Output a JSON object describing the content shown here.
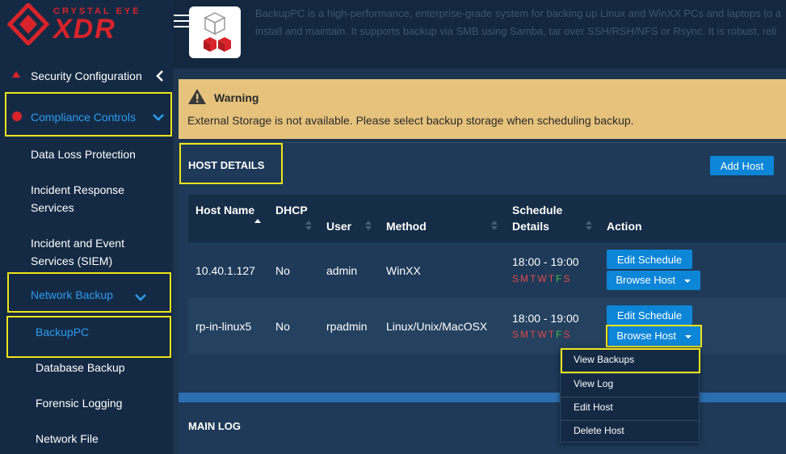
{
  "brand": {
    "tagline": "CRYSTAL EYE",
    "name": "XDR"
  },
  "sidebar": {
    "security_configuration": "Security Configuration",
    "compliance_controls": "Compliance Controls",
    "items": {
      "data_loss_protection": "Data Loss Protection",
      "incident_response_1": "Incident Response",
      "incident_response_2": "Services",
      "incident_event_1": "Incident and Event",
      "incident_event_2": "Services (SIEM)",
      "network_backup": "Network Backup",
      "backuppc": "BackupPC",
      "database_backup": "Database Backup",
      "forensic_logging": "Forensic Logging",
      "network_file": "Network File"
    }
  },
  "header": {
    "description_line1": "BackupPC is a high-performance, enterprise-grade system for backing up Linux and WinXX PCs and laptops to a",
    "description_line2": "install and maintain. It supports backup via SMB using Samba, tar over SSH/RSH/NFS or Rsync. It is robust, reli"
  },
  "warning": {
    "title": "Warning",
    "message": "External Storage is not available. Please select backup storage when scheduling backup."
  },
  "host_details": {
    "title": "HOST DETAILS",
    "add_host_label": "Add Host",
    "columns": {
      "host_name": "Host Name",
      "dhcp": "DHCP",
      "user": "User",
      "method": "Method",
      "schedule_1": "Schedule",
      "schedule_2": "Details",
      "action": "Action"
    },
    "rows": [
      {
        "host": "10.40.1.127",
        "dhcp": "No",
        "user": "admin",
        "method": "WinXX",
        "time": "18:00 - 19:00"
      },
      {
        "host": "rp-in-linux5",
        "dhcp": "No",
        "user": "rpadmin",
        "method": "Linux/Unix/MacOSX",
        "time": "18:00 - 19:00"
      }
    ],
    "days": [
      "S",
      "M",
      "T",
      "W",
      "T",
      "F",
      "S"
    ],
    "edit_schedule_label": "Edit Schedule",
    "browse_host_label": "Browse Host",
    "menu": {
      "view_backups": "View Backups",
      "view_log": "View Log",
      "edit_host": "Edit Host",
      "delete_host": "Delete Host"
    }
  },
  "main_log": {
    "title": "MAIN LOG"
  },
  "colors": {
    "accent": "#0d86d8",
    "highlight": "#f1e31b",
    "day_red": "#e04848",
    "day_green": "#3fbf4a",
    "brand": "#d8232a"
  }
}
